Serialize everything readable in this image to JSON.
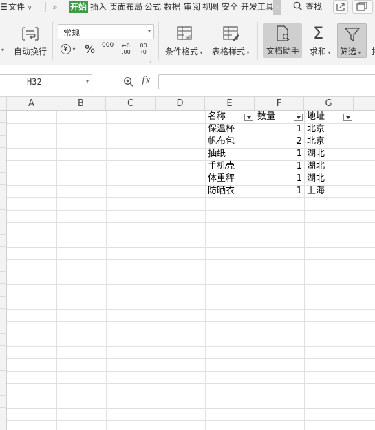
{
  "menu": {
    "file_label": "文件",
    "tabs": [
      "开始",
      "插入",
      "页面布局",
      "公式",
      "数据",
      "审阅",
      "视图",
      "安全",
      "开发工具"
    ],
    "active_tab": "开始",
    "search_label": "查找"
  },
  "ribbon": {
    "wrap_text_label": "自动换行",
    "number_format_value": "常规",
    "currency_glyph": "¥",
    "percent_glyph": "%",
    "thousands_glyph": "000",
    "dec_increase_glyph": "←0 .00",
    "dec_decrease_glyph": ".00 →0",
    "conditional_format_label": "条件格式",
    "table_style_label": "表格样式",
    "doc_assistant_label": "文档助手",
    "sum_label": "求和",
    "filter_label": "筛选"
  },
  "formula_bar": {
    "cell_ref": "H32",
    "fx_label": "fx",
    "formula_value": ""
  },
  "grid": {
    "columns": [
      "A",
      "B",
      "C",
      "D",
      "E",
      "F",
      "G"
    ],
    "headers": [
      "名称",
      "数量",
      "地址"
    ],
    "rows": [
      {
        "name": "保温杯",
        "qty": "1",
        "addr": "北京"
      },
      {
        "name": "帆布包",
        "qty": "2",
        "addr": "北京"
      },
      {
        "name": "抽纸",
        "qty": "1",
        "addr": "湖北"
      },
      {
        "name": "手机壳",
        "qty": "1",
        "addr": "湖北"
      },
      {
        "name": "体重秤",
        "qty": "1",
        "addr": "湖北"
      },
      {
        "name": "防晒衣",
        "qty": "1",
        "addr": "上海"
      }
    ]
  },
  "colors": {
    "active_tab_bg": "#3e9c47",
    "row_number_color": "#4a72c0",
    "selected_button_bg": "#cfcfcf"
  }
}
